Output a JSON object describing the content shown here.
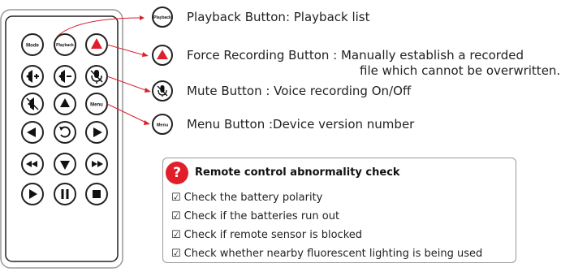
{
  "remote": {
    "mode_label": "Mode",
    "playback_label": "Playback",
    "menu_label": "Menu"
  },
  "callouts": {
    "playback": {
      "badge": "Playback",
      "text": "Playback Button: Playback list"
    },
    "force": {
      "line1": "Force Recording Button : Manually establish a recorded",
      "line2": "file which cannot be overwritten."
    },
    "mute": {
      "text": "Mute Button : Voice recording On/Off"
    },
    "menu": {
      "badge": "Menu",
      "text": "Menu Button :Device version number"
    }
  },
  "check": {
    "icon": "?",
    "title": "Remote control abnormality check",
    "checkbox_glyph": "☑",
    "items": [
      "Check the battery polarity",
      "Check if the batteries run out",
      "Check if remote sensor is blocked",
      "Check whether nearby fluorescent lighting is being used"
    ]
  },
  "colors": {
    "accent_red": "#e01f2b",
    "line_red": "#d8232f",
    "outline": "#222222"
  }
}
